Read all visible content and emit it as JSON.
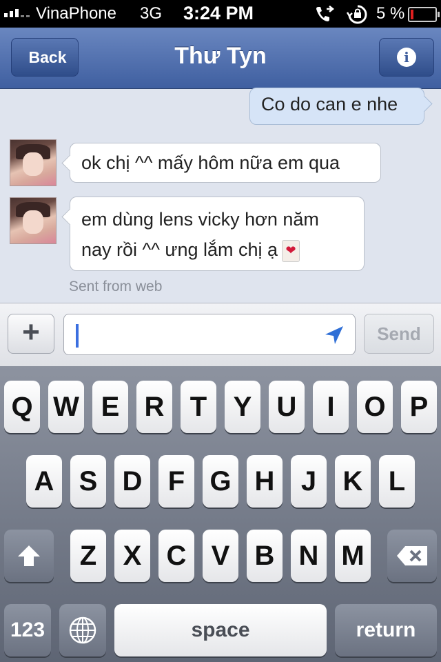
{
  "status_bar": {
    "carrier": "VinaPhone",
    "network": "3G",
    "time": "3:24 PM",
    "battery_percent": "5 %",
    "battery_level": 0.05,
    "battery_color": "#e02020"
  },
  "nav": {
    "back_label": "Back",
    "title": "Thư Tyn",
    "info_icon": "i"
  },
  "messages": [
    {
      "direction": "out",
      "text": "Co do can e nhe"
    },
    {
      "direction": "in",
      "text": "ok chị ^^ mấy hôm nữa em qua"
    },
    {
      "direction": "in",
      "line1": "em dùng lens vicky hơn năm",
      "line2": "nay rồi ^^ ưng lắm chị ạ",
      "emoji": "heart-emoji"
    }
  ],
  "sent_from": "Sent from web",
  "compose": {
    "plus_label": "+",
    "input_value": "",
    "send_label": "Send"
  },
  "keyboard": {
    "row1": [
      "Q",
      "W",
      "E",
      "R",
      "T",
      "Y",
      "U",
      "I",
      "O",
      "P"
    ],
    "row2": [
      "A",
      "S",
      "D",
      "F",
      "G",
      "H",
      "J",
      "K",
      "L"
    ],
    "row3": [
      "Z",
      "X",
      "C",
      "V",
      "B",
      "N",
      "M"
    ],
    "numbers_label": "123",
    "space_label": "space",
    "return_label": "return"
  },
  "colors": {
    "nav_blue": "#4a6aa8",
    "outgoing_bubble": "#d6e4f7",
    "caret": "#3b6fe0"
  }
}
